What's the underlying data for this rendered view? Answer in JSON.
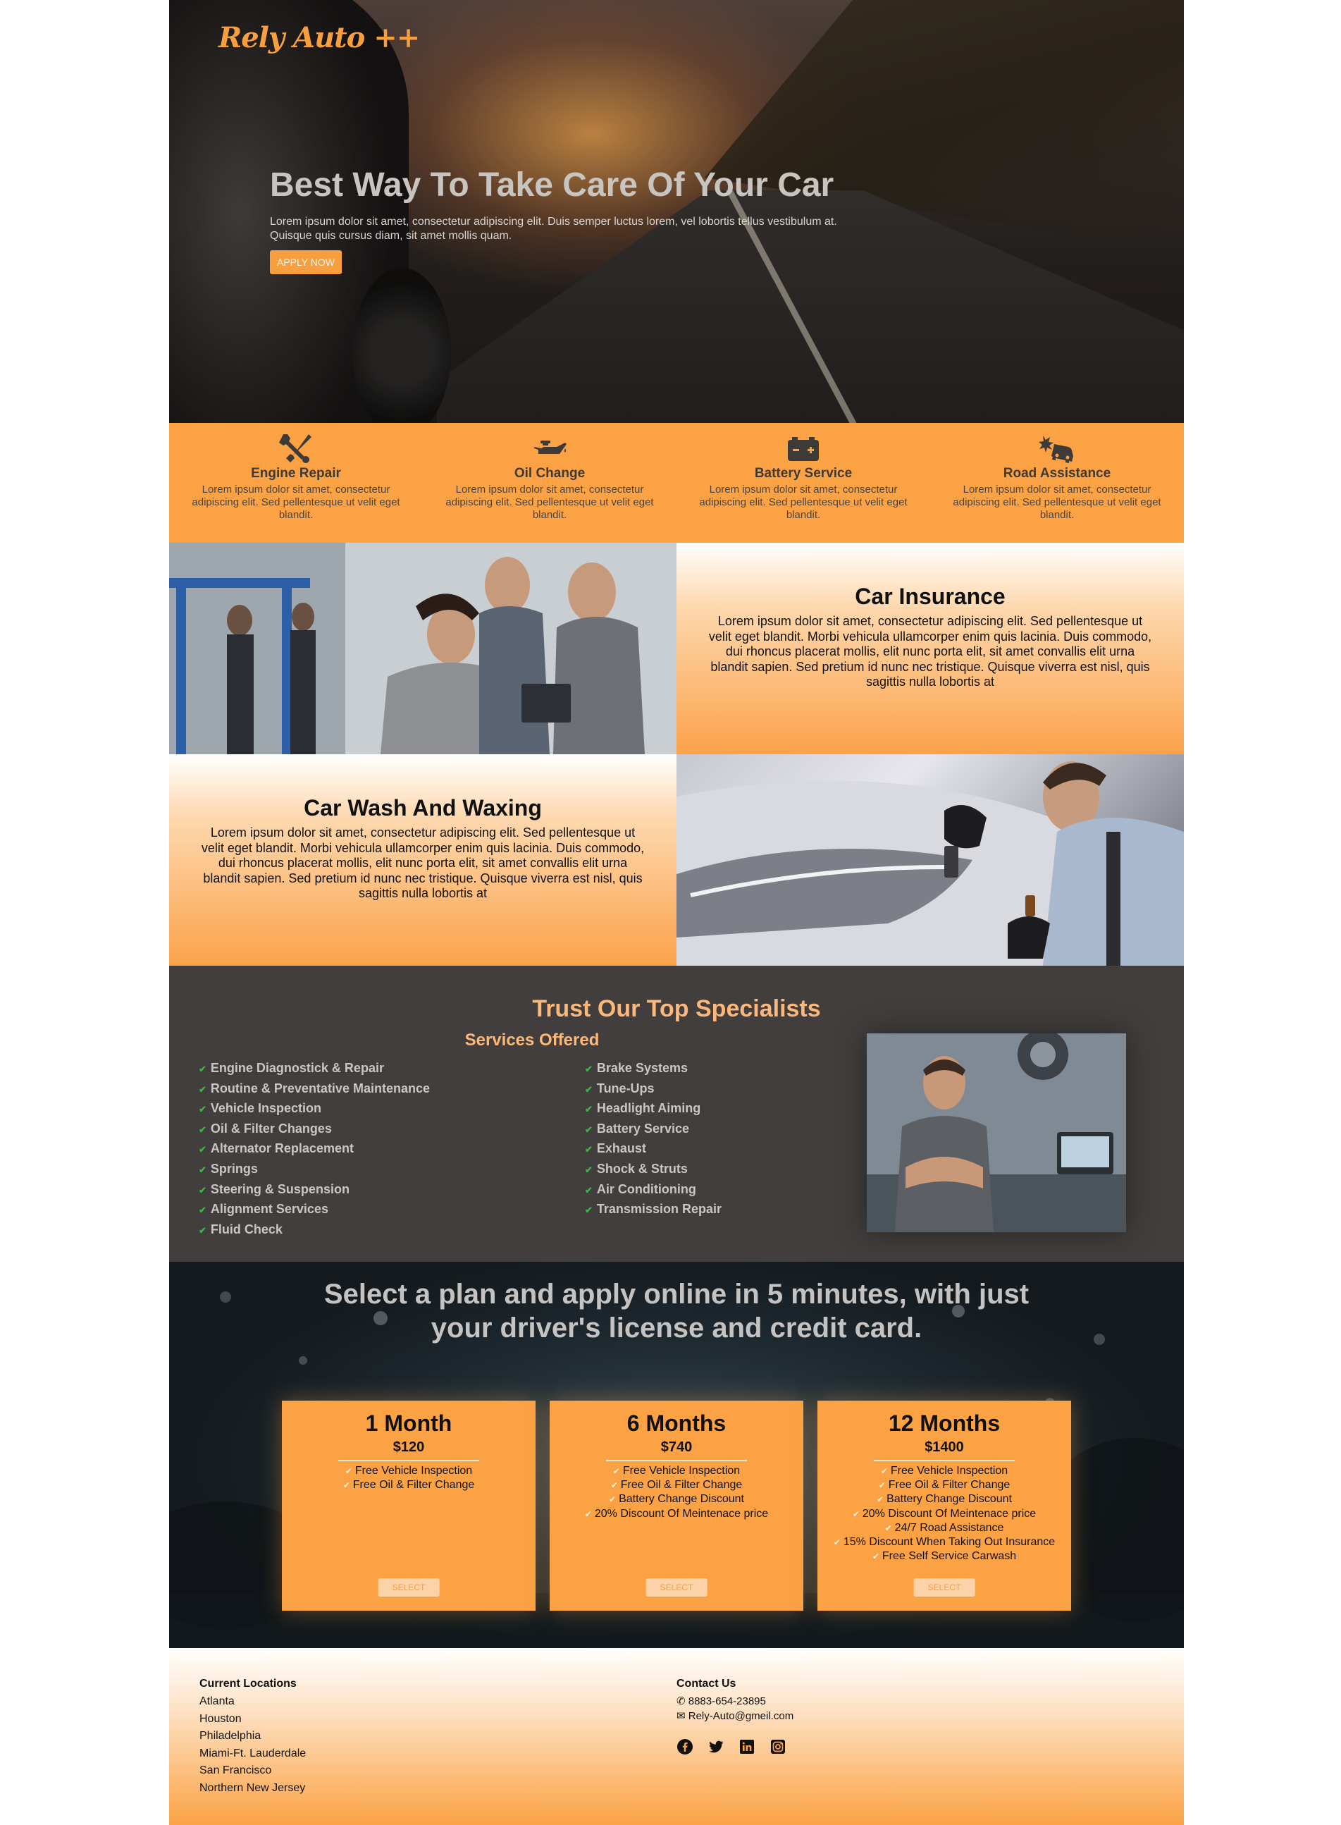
{
  "brand": {
    "logo": "Rely Auto ++"
  },
  "hero": {
    "title": "Best Way To Take Care Of Your Car",
    "text": "Lorem ipsum dolor sit amet, consectetur adipiscing elit. Duis semper luctus lorem, vel lobortis tellus vestibulum at. Quisque quis cursus diam, sit amet mollis quam.",
    "cta": "APPLY NOW"
  },
  "features": [
    {
      "icon": "wrench-screwdriver-icon",
      "title": "Engine Repair",
      "text": "Lorem ipsum dolor sit amet, consectetur adipiscing elit. Sed pellentesque ut velit eget blandit."
    },
    {
      "icon": "oil-can-icon",
      "title": "Oil Change",
      "text": "Lorem ipsum dolor sit amet, consectetur adipiscing elit. Sed pellentesque ut velit eget blandit."
    },
    {
      "icon": "car-battery-icon",
      "title": "Battery Service",
      "text": "Lorem ipsum dolor sit amet, consectetur adipiscing elit. Sed pellentesque ut velit eget blandit."
    },
    {
      "icon": "car-crash-icon",
      "title": "Road Assistance",
      "text": "Lorem ipsum dolor sit amet, consectetur adipiscing elit. Sed pellentesque ut velit eget blandit."
    }
  ],
  "insurance": {
    "title": "Car Insurance",
    "text": "Lorem ipsum dolor sit amet, consectetur adipiscing elit. Sed pellentesque ut velit eget blandit. Morbi vehicula ullamcorper enim quis lacinia. Duis commodo, dui rhoncus placerat mollis, elit nunc porta elit, sit amet convallis elit urna blandit sapien. Sed pretium id nunc nec tristique. Quisque viverra est nisl, quis sagittis nulla lobortis at"
  },
  "wash": {
    "title": "Car Wash And Waxing",
    "text": "Lorem ipsum dolor sit amet, consectetur adipiscing elit. Sed pellentesque ut velit eget blandit. Morbi vehicula ullamcorper enim quis lacinia. Duis commodo, dui rhoncus placerat mollis, elit nunc porta elit, sit amet convallis elit urna blandit sapien. Sed pretium id nunc nec tristique. Quisque viverra est nisl, quis sagittis nulla lobortis at"
  },
  "specialists": {
    "title": "Trust Our Top Specialists",
    "subtitle": "Services Offered",
    "left": [
      "Engine Diagnostick & Repair",
      "Routine & Preventative Maintenance",
      "Vehicle Inspection",
      "Oil & Filter Changes",
      "Alternator Replacement",
      "Springs",
      "Steering & Suspension",
      "Alignment Services",
      "Fluid Check"
    ],
    "right": [
      "Brake Systems",
      "Tune-Ups",
      "Headlight Aiming",
      "Battery Service",
      "Exhaust",
      "Shock & Struts",
      "Air Conditioning",
      "Transmission Repair"
    ]
  },
  "plans": {
    "title": "Select a plan and apply online in 5 minutes, with just your driver's license and credit card.",
    "select_label": "SELECT",
    "items": [
      {
        "name": "1 Month",
        "price": "$120",
        "features": [
          "Free Vehicle Inspection",
          "Free Oil & Filter Change"
        ]
      },
      {
        "name": "6 Months",
        "price": "$740",
        "features": [
          "Free Vehicle Inspection",
          "Free Oil & Filter Change",
          "Battery Change Discount",
          "20% Discount Of Meintenace price"
        ]
      },
      {
        "name": "12 Months",
        "price": "$1400",
        "features": [
          "Free Vehicle Inspection",
          "Free Oil & Filter Change",
          "Battery Change Discount",
          "20% Discount Of Meintenace price",
          "24/7 Road Assistance",
          "15% Discount When Taking Out Insurance",
          "Free Self Service Carwash"
        ]
      }
    ]
  },
  "footer": {
    "locations_title": "Current Locations",
    "locations": [
      "Atlanta",
      "Houston",
      "Philadelphia",
      "Miami-Ft. Lauderdale",
      "San Francisco",
      "Northern New Jersey"
    ],
    "contact_title": "Contact Us",
    "phone": "8883-654-23895",
    "email": "Rely-Auto@gmeil.com",
    "socials": [
      "facebook-icon",
      "twitter-icon",
      "linkedin-icon",
      "instagram-icon"
    ]
  },
  "colors": {
    "accent": "#fba244",
    "dark": "#413e3d",
    "peach": "#fcb77a"
  }
}
